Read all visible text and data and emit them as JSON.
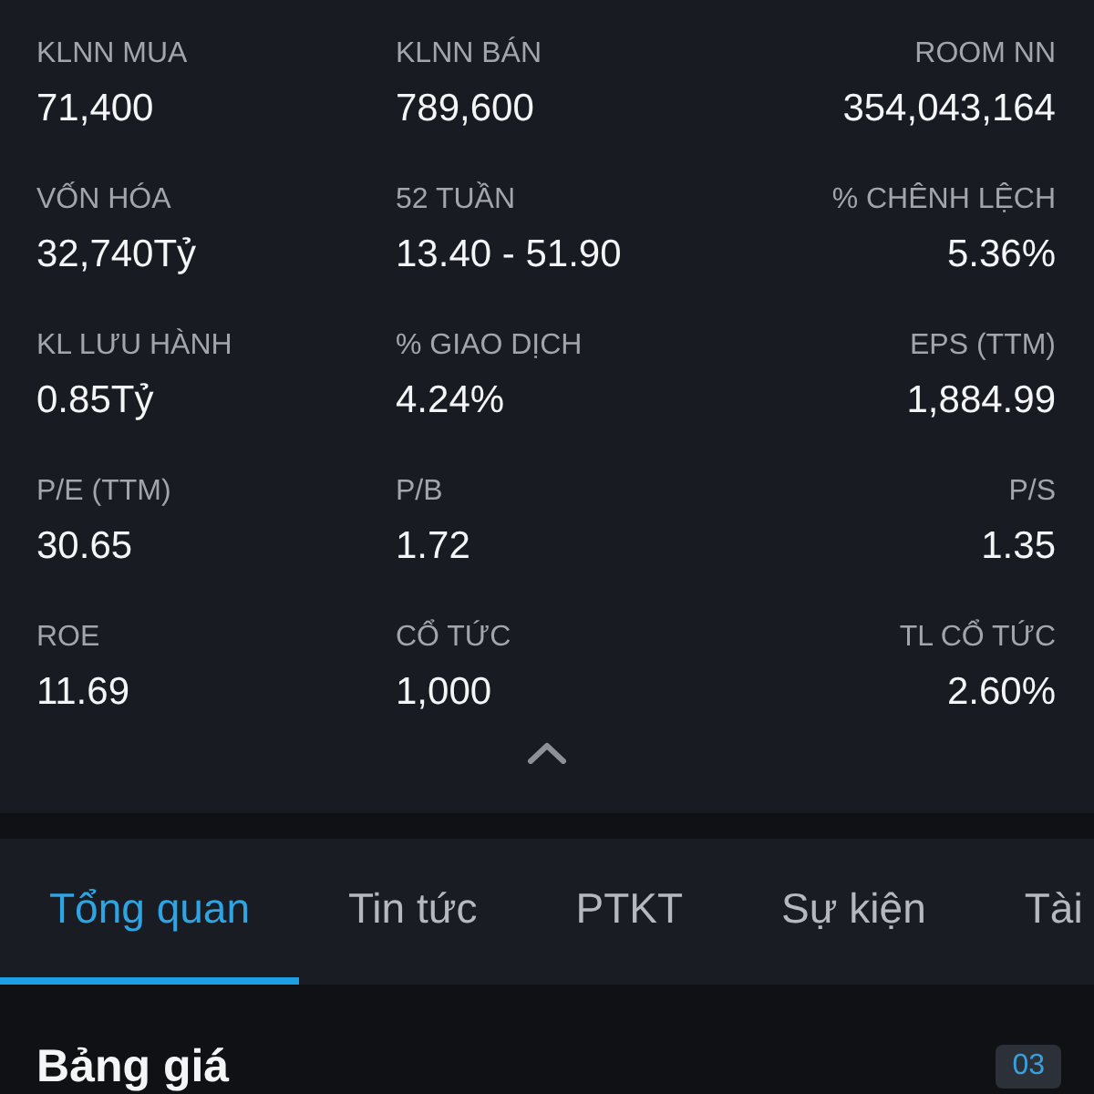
{
  "stats": [
    {
      "label": "KLNN MUA",
      "value": "71,400"
    },
    {
      "label": "KLNN BÁN",
      "value": "789,600"
    },
    {
      "label": "ROOM NN",
      "value": "354,043,164"
    },
    {
      "label": "VỐN HÓA",
      "value": "32,740Tỷ"
    },
    {
      "label": "52 TUẦN",
      "value": "13.40 - 51.90"
    },
    {
      "label": "% CHÊNH LỆCH",
      "value": "5.36%"
    },
    {
      "label": "KL LƯU HÀNH",
      "value": "0.85Tỷ"
    },
    {
      "label": "% GIAO DỊCH",
      "value": "4.24%"
    },
    {
      "label": "EPS (TTM)",
      "value": "1,884.99"
    },
    {
      "label": "P/E (TTM)",
      "value": "30.65"
    },
    {
      "label": "P/B",
      "value": "1.72"
    },
    {
      "label": "P/S",
      "value": "1.35"
    },
    {
      "label": "ROE",
      "value": "11.69"
    },
    {
      "label": "CỔ TỨC",
      "value": "1,000"
    },
    {
      "label": "TL CỔ TỨC",
      "value": "2.60%"
    }
  ],
  "details_toggle": {
    "expanded": true
  },
  "tabs": [
    {
      "label": "Tổng quan",
      "selected": true
    },
    {
      "label": "Tin tức",
      "selected": false
    },
    {
      "label": "PTKT",
      "selected": false
    },
    {
      "label": "Sự kiện",
      "selected": false
    },
    {
      "label": "Tài",
      "selected": false
    }
  ],
  "section": {
    "title": "Bảng giá",
    "badge": "03"
  }
}
